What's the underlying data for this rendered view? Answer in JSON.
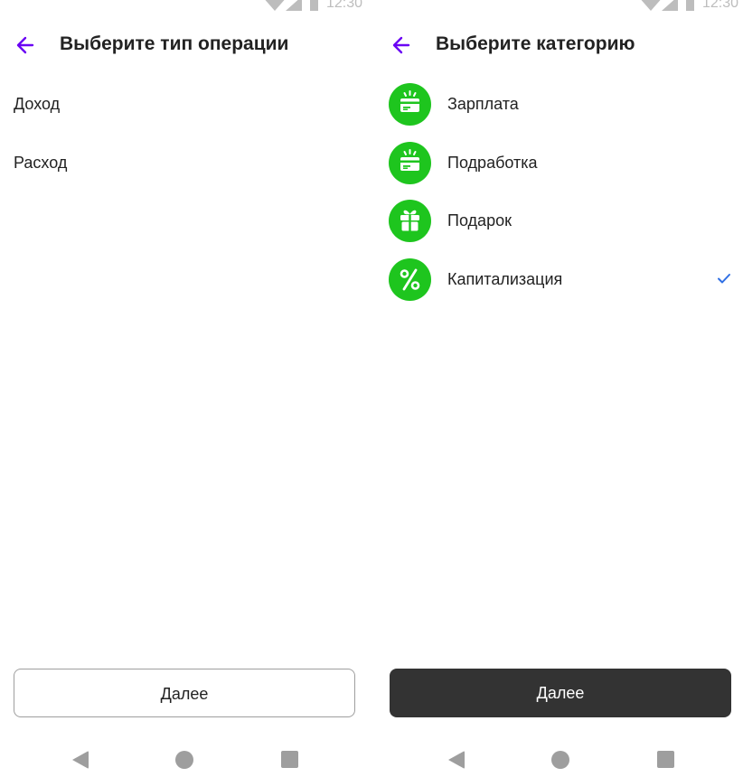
{
  "left_screen": {
    "status_bar": {
      "time": "12:30"
    },
    "title": "Выберите тип операции",
    "items": [
      {
        "label": "Доход"
      },
      {
        "label": "Расход"
      }
    ],
    "next_button": "Далее"
  },
  "right_screen": {
    "status_bar": {
      "time": "12:30"
    },
    "title": "Выберите категорию",
    "items": [
      {
        "label": "Зарплата",
        "icon": "salary-card-icon"
      },
      {
        "label": "Подработка",
        "icon": "side-job-card-icon"
      },
      {
        "label": "Подарок",
        "icon": "gift-icon"
      },
      {
        "label": "Капитализация",
        "icon": "percent-icon",
        "selected": true
      }
    ],
    "next_button": "Далее"
  },
  "colors": {
    "accent": "#6a00f4",
    "category_icon_bg": "#1ec51e",
    "checkmark": "#2f6fe4",
    "button_filled_bg": "#333333",
    "system_gray": "#9e9e9e"
  },
  "navigation": {
    "icons": [
      "back-triangle-icon",
      "home-circle-icon",
      "recents-square-icon"
    ]
  }
}
